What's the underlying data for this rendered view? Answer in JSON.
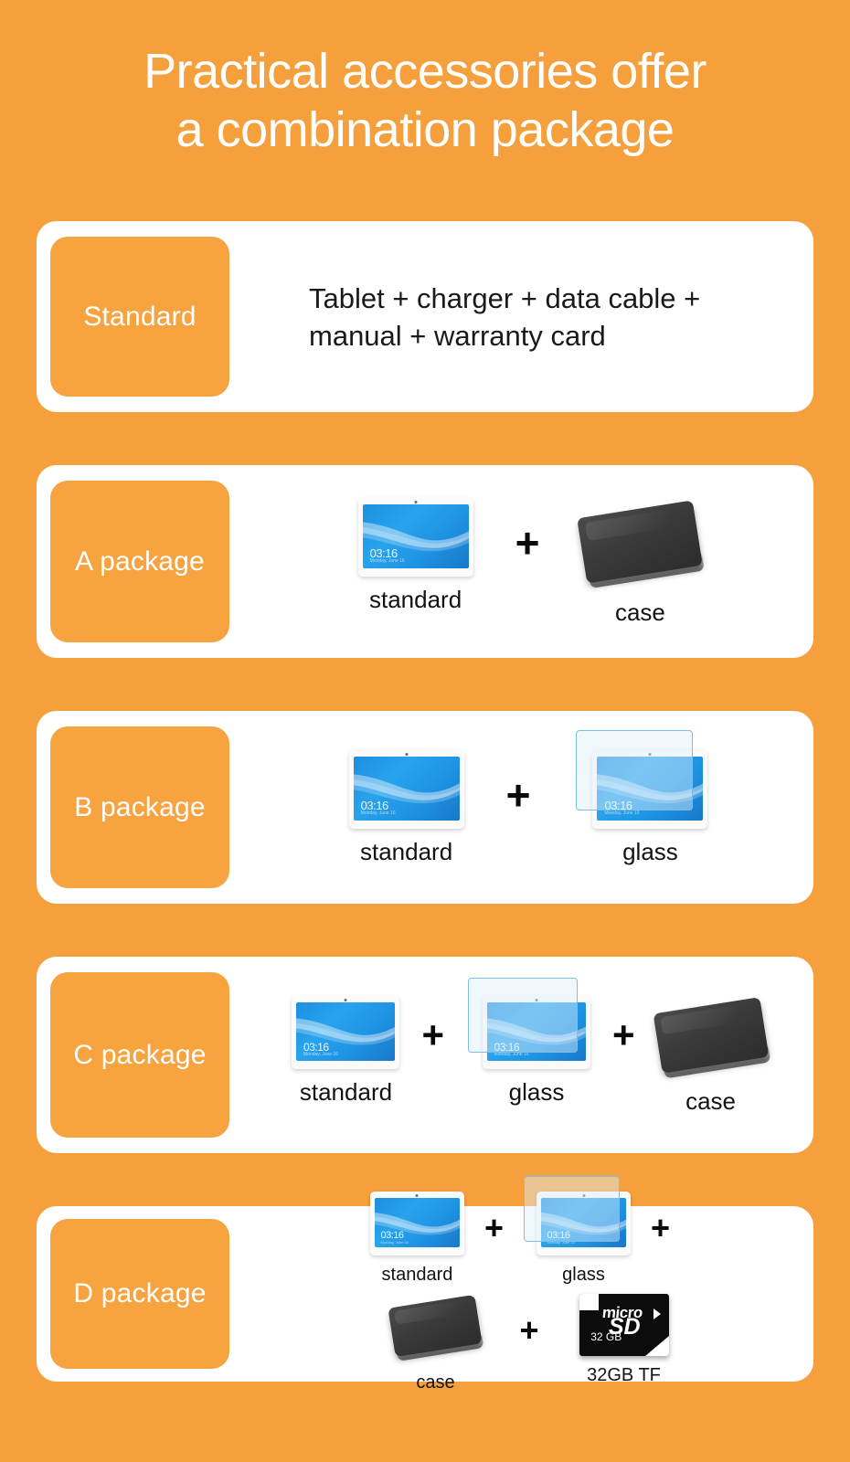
{
  "page": {
    "background_color": "#f5a03c",
    "card_color": "#ffffff",
    "chip_color": "#f6a340",
    "text_color": "#1a1a1a"
  },
  "title": {
    "line1": "Practical accessories offer",
    "line2": "a combination package"
  },
  "device": {
    "clock": "03:16",
    "clock_sub": "Monday, June 16"
  },
  "sd": {
    "brand": "micro",
    "logo": "SD",
    "capacity": "32 GB"
  },
  "rows": [
    {
      "id": "standard",
      "label": "Standard",
      "description": "Tablet + charger + data cable + manual + warranty card"
    },
    {
      "id": "a-package",
      "label": "A package",
      "items": [
        {
          "caption": "standard",
          "type": "tablet"
        },
        {
          "caption": "case",
          "type": "case"
        }
      ],
      "separator": "+"
    },
    {
      "id": "b-package",
      "label": "B package",
      "items": [
        {
          "caption": "standard",
          "type": "tablet"
        },
        {
          "caption": "glass",
          "type": "glass"
        }
      ],
      "separator": "+"
    },
    {
      "id": "c-package",
      "label": "C package",
      "items": [
        {
          "caption": "standard",
          "type": "tablet"
        },
        {
          "caption": "glass",
          "type": "glass"
        },
        {
          "caption": "case",
          "type": "case"
        }
      ],
      "separator": "+"
    },
    {
      "id": "d-package",
      "label": "D package",
      "items": [
        {
          "caption": "standard",
          "type": "tablet"
        },
        {
          "caption": "glass",
          "type": "glass"
        },
        {
          "caption": "case",
          "type": "case"
        },
        {
          "caption": "32GB TF",
          "type": "sdcard"
        }
      ],
      "separator": "+"
    }
  ]
}
